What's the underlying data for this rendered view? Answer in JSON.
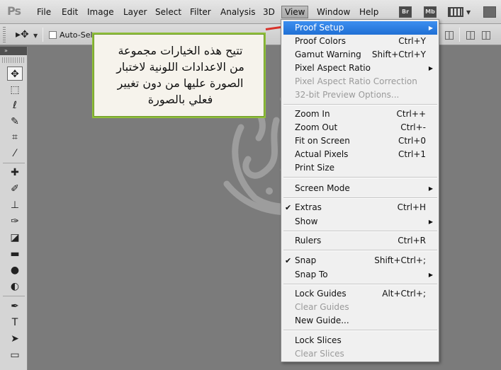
{
  "app": {
    "logo": "Ps"
  },
  "menubar": {
    "items": [
      "File",
      "Edit",
      "Image",
      "Layer",
      "Select",
      "Filter",
      "Analysis",
      "3D",
      "View",
      "Window",
      "Help"
    ],
    "bridge_label": "Br",
    "minibridge_label": "Mb"
  },
  "options_bar": {
    "auto_select_label": "Auto-Sele"
  },
  "callout": {
    "text": "تتيح هذه الخيارات مجموعة\nمن الاعدادات اللونية لاختبار\nالصورة عليها من دون تغيير\nفعلي بالصورة",
    "border_color": "#8fbe3a",
    "arrow_color": "#d8322a"
  },
  "view_menu": {
    "highlight_color": "#2a7de1",
    "items": [
      {
        "label": "Proof Setup",
        "shortcut": "",
        "submenu": true,
        "highlighted": true
      },
      {
        "label": "Proof Colors",
        "shortcut": "Ctrl+Y"
      },
      {
        "label": "Gamut Warning",
        "shortcut": "Shift+Ctrl+Y"
      },
      {
        "label": "Pixel Aspect Ratio",
        "shortcut": "",
        "submenu": true
      },
      {
        "label": "Pixel Aspect Ratio Correction",
        "shortcut": "",
        "disabled": true
      },
      {
        "label": "32-bit Preview Options...",
        "shortcut": "",
        "disabled": true
      },
      {
        "label": "Zoom In",
        "shortcut": "Ctrl++"
      },
      {
        "label": "Zoom Out",
        "shortcut": "Ctrl+-"
      },
      {
        "label": "Fit on Screen",
        "shortcut": "Ctrl+0"
      },
      {
        "label": "Actual Pixels",
        "shortcut": "Ctrl+1"
      },
      {
        "label": "Print Size",
        "shortcut": ""
      },
      {
        "label": "Screen Mode",
        "shortcut": "",
        "submenu": true
      },
      {
        "label": "Extras",
        "shortcut": "Ctrl+H",
        "checked": true
      },
      {
        "label": "Show",
        "shortcut": "",
        "submenu": true
      },
      {
        "label": "Rulers",
        "shortcut": "Ctrl+R"
      },
      {
        "label": "Snap",
        "shortcut": "Shift+Ctrl+;",
        "checked": true
      },
      {
        "label": "Snap To",
        "shortcut": "",
        "submenu": true
      },
      {
        "label": "Lock Guides",
        "shortcut": "Alt+Ctrl+;"
      },
      {
        "label": "Clear Guides",
        "shortcut": "",
        "disabled": true
      },
      {
        "label": "New Guide...",
        "shortcut": ""
      },
      {
        "label": "Lock Slices",
        "shortcut": ""
      },
      {
        "label": "Clear Slices",
        "shortcut": "",
        "disabled": true
      }
    ]
  },
  "tools": [
    "move-icon",
    "marquee-icon",
    "lasso-icon",
    "quick-select-icon",
    "crop-icon",
    "eyedropper-icon",
    "healing-brush-icon",
    "brush-icon",
    "clone-stamp-icon",
    "history-brush-icon",
    "eraser-icon",
    "gradient-icon",
    "blur-icon",
    "dodge-icon",
    "pen-icon",
    "type-icon",
    "path-select-icon",
    "rectangle-shape-icon"
  ]
}
